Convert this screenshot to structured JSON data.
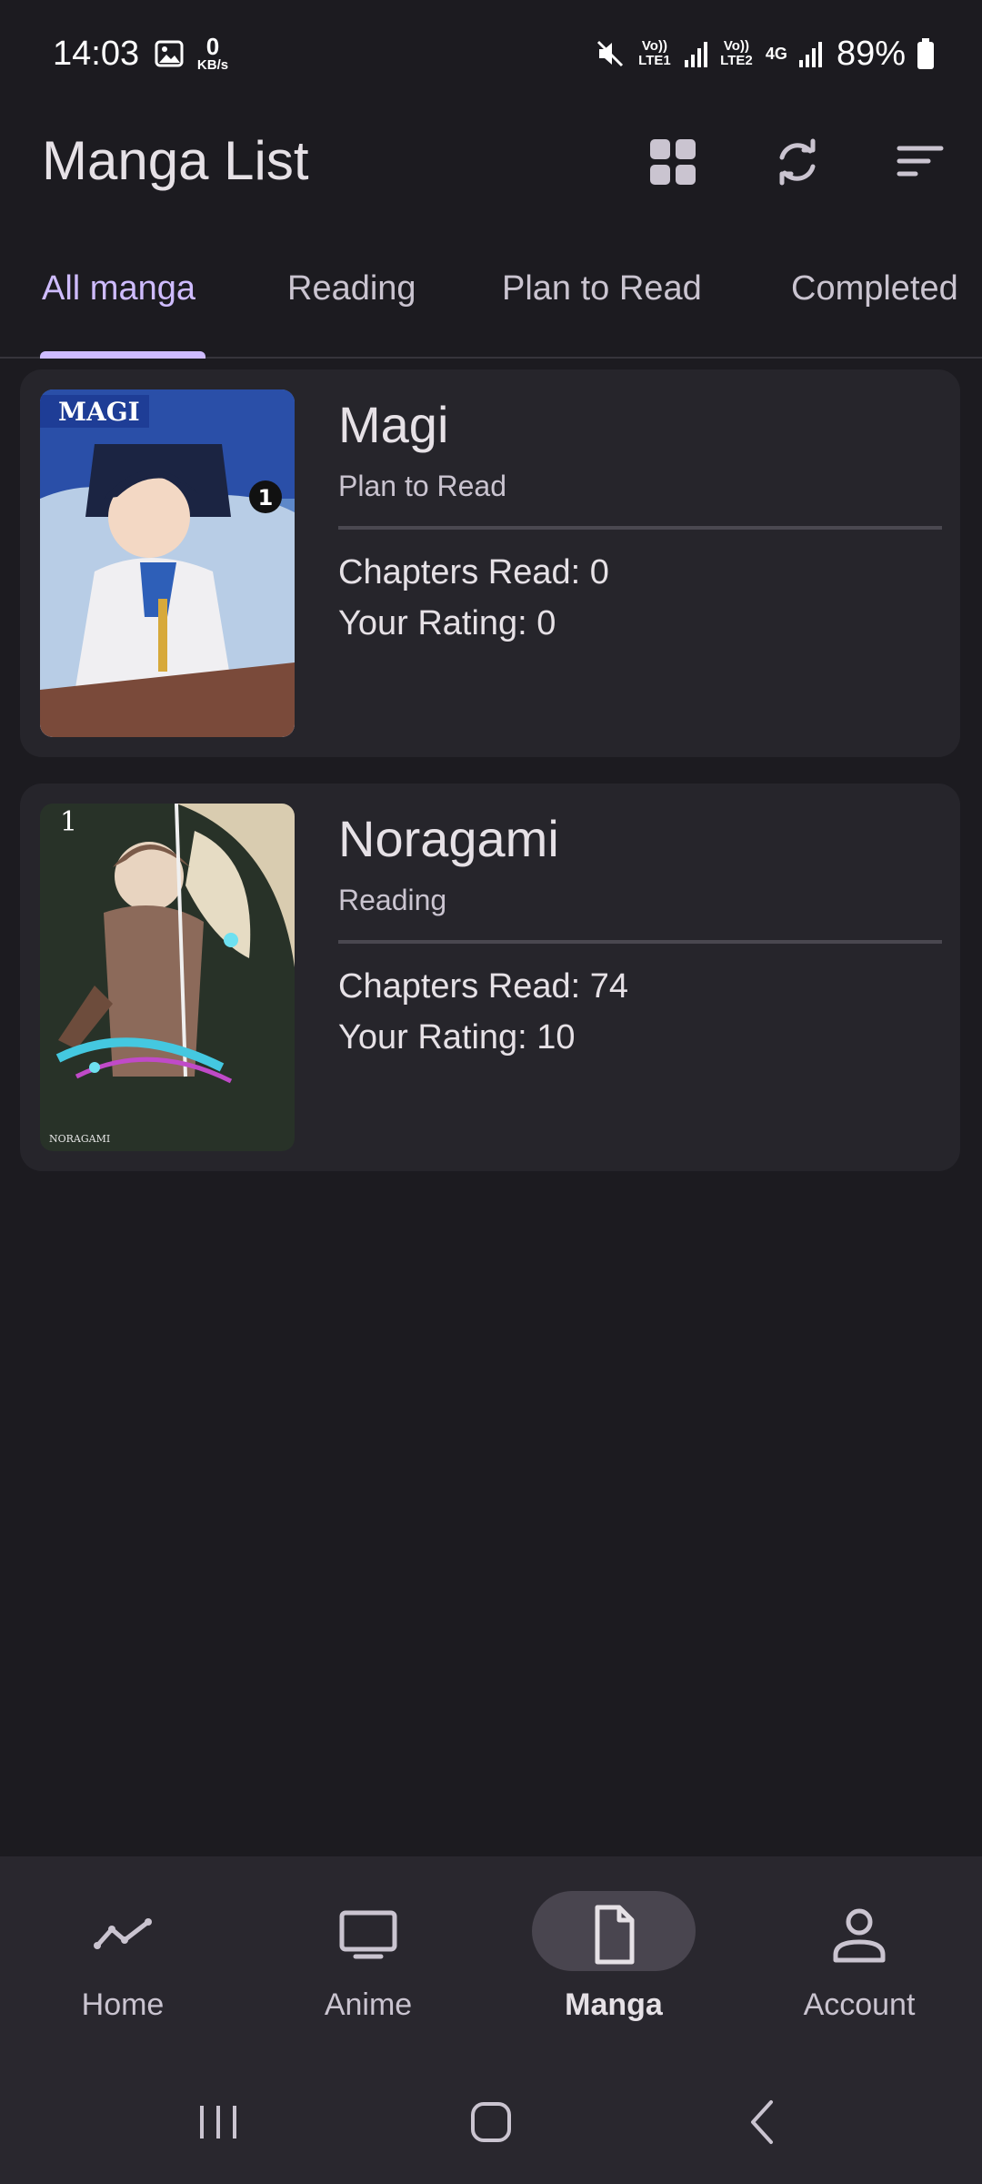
{
  "status_bar": {
    "time": "14:03",
    "net_speed_value": "0",
    "net_speed_unit": "KB/s",
    "sim1": "Vo)) LTE1",
    "sim2": "Vo)) LTE2",
    "sim2_net": "4G",
    "battery": "89%"
  },
  "app_bar": {
    "title": "Manga List",
    "actions": [
      "grid-view-icon",
      "refresh-icon",
      "sort-icon"
    ]
  },
  "tabs": [
    {
      "label": "All manga",
      "active": true
    },
    {
      "label": "Reading",
      "active": false
    },
    {
      "label": "Plan to Read",
      "active": false
    },
    {
      "label": "Completed",
      "active": false
    }
  ],
  "manga": [
    {
      "title": "Magi",
      "status": "Plan to Read",
      "chapters": "Chapters Read: 0",
      "rating": "Your Rating: 0",
      "cover_text": "MAGI",
      "cover_volume": "1"
    },
    {
      "title": "Noragami",
      "status": "Reading",
      "chapters": "Chapters Read: 74",
      "rating": "Your Rating: 10",
      "cover_text": "NORAGAMI",
      "cover_volume": "1"
    }
  ],
  "bottom_nav": [
    {
      "label": "Home",
      "icon": "trend-icon",
      "active": false
    },
    {
      "label": "Anime",
      "icon": "tv-icon",
      "active": false
    },
    {
      "label": "Manga",
      "icon": "document-icon",
      "active": true
    },
    {
      "label": "Account",
      "icon": "person-icon",
      "active": false
    }
  ],
  "colors": {
    "background": "#1c1b20",
    "card": "#26252b",
    "accent": "#cfbcff",
    "nav_bar": "#29272e",
    "nav_indicator": "#49454f"
  }
}
